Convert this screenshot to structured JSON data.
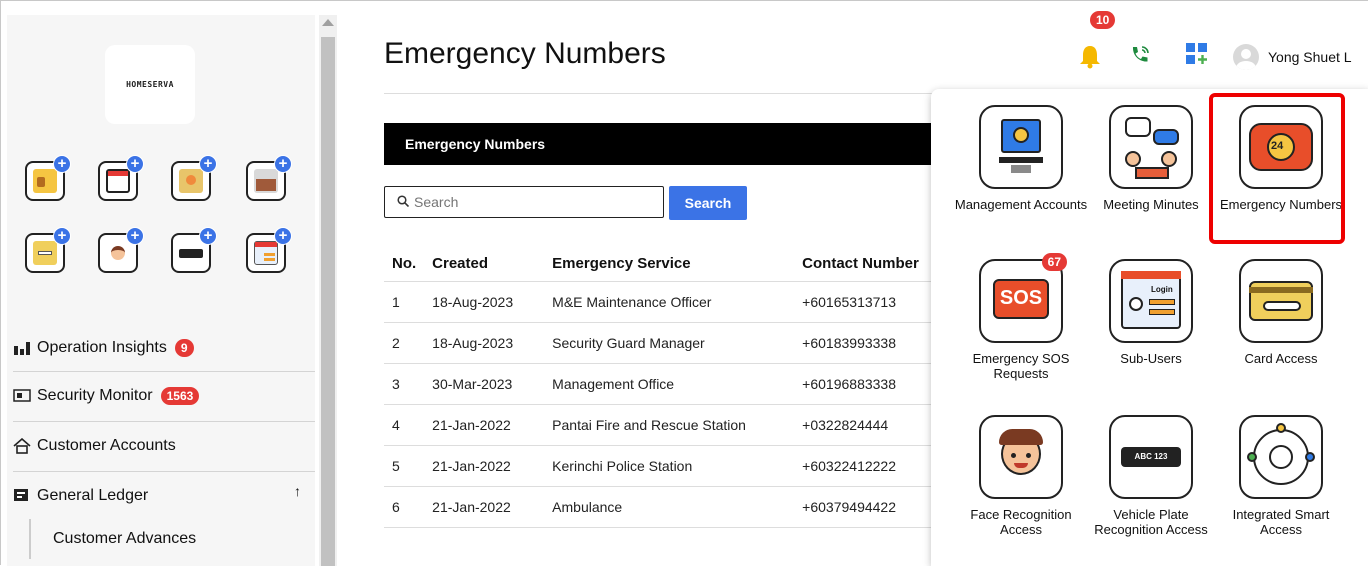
{
  "brand": {
    "logo_text": "HOMESERVA"
  },
  "sidebar": {
    "nav_items": [
      {
        "label": "Operation Insights",
        "badge": "9"
      },
      {
        "label": "Security Monitor",
        "badge": "1563"
      },
      {
        "label": "Customer Accounts"
      },
      {
        "label": "General Ledger",
        "arrow": "↑"
      }
    ],
    "sub_item": "Customer Advances"
  },
  "main": {
    "title": "Emergency Numbers",
    "section_title": "Emergency Numbers",
    "search": {
      "placeholder": "Search",
      "button": "Search"
    },
    "table": {
      "headers": [
        "No.",
        "Created",
        "Emergency Service",
        "Contact Number"
      ],
      "rows": [
        [
          "1",
          "18-Aug-2023",
          "M&E Maintenance Officer",
          "+60165313713"
        ],
        [
          "2",
          "18-Aug-2023",
          "Security Guard Manager",
          "+60183993338"
        ],
        [
          "3",
          "30-Mar-2023",
          "Management Office",
          "+60196883338"
        ],
        [
          "4",
          "21-Jan-2022",
          "Pantai Fire and Rescue Station",
          "+0322824444"
        ],
        [
          "5",
          "21-Jan-2022",
          "Kerinchi Police Station",
          "+60322412222"
        ],
        [
          "6",
          "21-Jan-2022",
          "Ambulance",
          "+60379494422"
        ]
      ]
    }
  },
  "header": {
    "notification_count": "10",
    "user_name": "Yong Shuet L"
  },
  "apps_menu": {
    "items": [
      {
        "label": "Management Accounts",
        "icon": "management-accounts-icon"
      },
      {
        "label": "Meeting Minutes",
        "icon": "meeting-minutes-icon"
      },
      {
        "label": "Emergency Numbers",
        "icon": "emergency-phone-icon",
        "selected": true
      },
      {
        "label": "Emergency SOS Requests",
        "icon": "sos-icon",
        "badge": "67"
      },
      {
        "label": "Sub-Users",
        "icon": "sub-users-icon"
      },
      {
        "label": "Card Access",
        "icon": "card-access-icon"
      },
      {
        "label": "Face Recognition Access",
        "icon": "face-recognition-icon"
      },
      {
        "label": "Vehicle Plate Recognition Access",
        "icon": "vehicle-plate-icon",
        "plate_text": "ABC 123"
      },
      {
        "label": "Integrated Smart Access",
        "icon": "smart-access-icon"
      }
    ]
  },
  "colors": {
    "accent": "#3b73e6",
    "badge": "#e53935",
    "highlight": "#e00000"
  }
}
